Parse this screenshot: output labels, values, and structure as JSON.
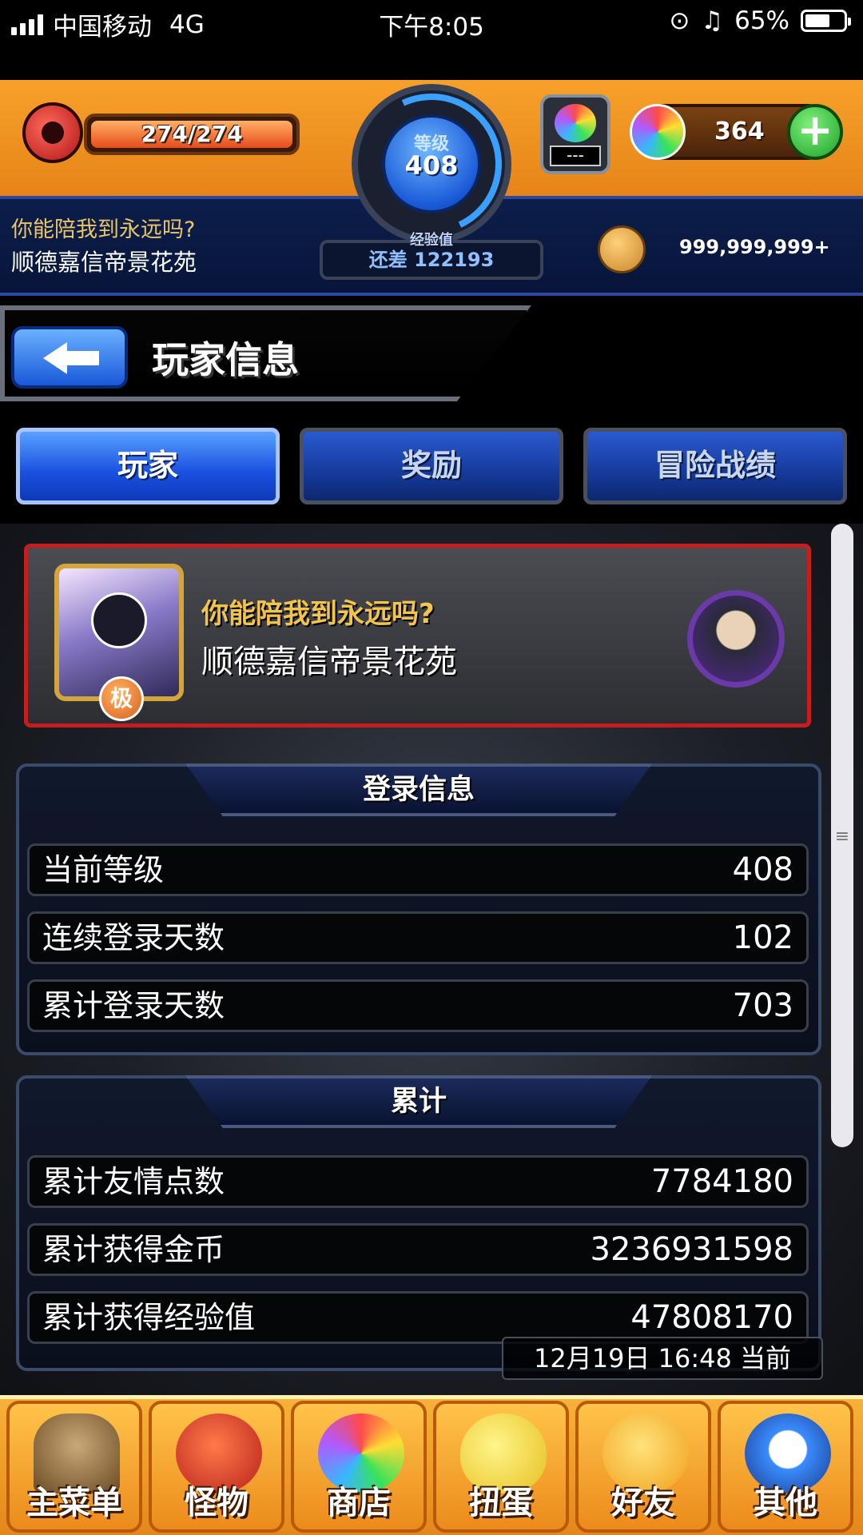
{
  "status_bar": {
    "carrier": "中国移动",
    "network": "4G",
    "time": "下午8:05",
    "battery": "65%",
    "battery_level": 0.65
  },
  "hud": {
    "stamina": "274/274",
    "stamina_fraction": 1.0,
    "level_label": "等级",
    "level": "408",
    "exp_label": "经验值",
    "exp_remaining": "还差 122193",
    "orb_slot": "---",
    "orbs": "364",
    "motto": "你能陪我到永远吗?",
    "player_name": "顺德嘉信帝景花苑",
    "coins": "999,999,999+"
  },
  "page": {
    "title": "玩家信息"
  },
  "tabs": [
    {
      "label": "玩家",
      "active": true
    },
    {
      "label": "奖励",
      "active": false
    },
    {
      "label": "冒险战绩",
      "active": false
    }
  ],
  "player_card": {
    "motto": "你能陪我到永远吗?",
    "name": "顺德嘉信帝景花苑",
    "rank_badge": "极"
  },
  "login_info": {
    "title": "登录信息",
    "rows": [
      {
        "label": "当前等级",
        "value": "408"
      },
      {
        "label": "连续登录天数",
        "value": "102"
      },
      {
        "label": "累计登录天数",
        "value": "703"
      }
    ]
  },
  "totals": {
    "title": "累计",
    "rows": [
      {
        "label": "累计友情点数",
        "value": "7784180"
      },
      {
        "label": "累计获得金币",
        "value": "3236931598"
      },
      {
        "label": "累计获得经验值",
        "value": "47808170"
      }
    ]
  },
  "timestamp": "12月19日 16:48 当前",
  "bottom_nav": [
    {
      "label": "主菜单",
      "icon": "gate-icon"
    },
    {
      "label": "怪物",
      "icon": "dragon-icon"
    },
    {
      "label": "商店",
      "icon": "rainbow-orb-icon"
    },
    {
      "label": "扭蛋",
      "icon": "egg-icon"
    },
    {
      "label": "好友",
      "icon": "balloons-icon"
    },
    {
      "label": "其他",
      "icon": "question-icon"
    }
  ],
  "colors": {
    "accent_orange": "#f7a12a",
    "tab_active": "#1850e0",
    "card_border": "#c41e1e",
    "motto_gold": "#f2c54a"
  }
}
